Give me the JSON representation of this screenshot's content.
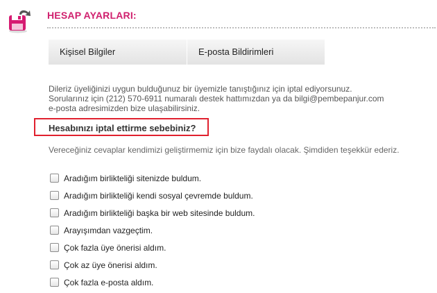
{
  "header": {
    "icon": "disk-return-icon",
    "title": "HESAP AYARLARI:"
  },
  "tabs": [
    {
      "label": "Kişisel Bilgiler"
    },
    {
      "label": "E-posta Bildirimleri"
    }
  ],
  "info": {
    "line1": "Dileriz üyeliğinizi uygun bulduğunuz bir üyemizle tanıştığınız için iptal ediyorsunuz.",
    "line2": "Sorularınız için (212) 570-6911 numaralı destek hattımızdan ya da bilgi@pembepanjur.com",
    "line3": "e-posta adresimizden bize ulaşabilirsiniz."
  },
  "question": {
    "title": "Hesabınızı iptal ettirme sebebiniz?",
    "subtext": "Vereceğiniz cevaplar kendimizi geliştirmemiz için bize faydalı olacak. Şimdiden teşekkür ederiz."
  },
  "options": [
    {
      "label": "Aradığım birlikteliği sitenizde buldum.",
      "checked": false
    },
    {
      "label": "Aradığım birlikteliği kendi sosyal çevremde buldum.",
      "checked": false
    },
    {
      "label": "Aradığım birlikteliği başka bir web sitesinde buldum.",
      "checked": false
    },
    {
      "label": "Arayışımdan vazgeçtim.",
      "checked": false
    },
    {
      "label": "Çok fazla üye önerisi aldım.",
      "checked": false
    },
    {
      "label": "Çok az üye önerisi aldım.",
      "checked": false
    },
    {
      "label": "Çok fazla e-posta aldım.",
      "checked": false
    }
  ],
  "colors": {
    "brand": "#d0206e",
    "highlight_border": "#e0202e"
  }
}
